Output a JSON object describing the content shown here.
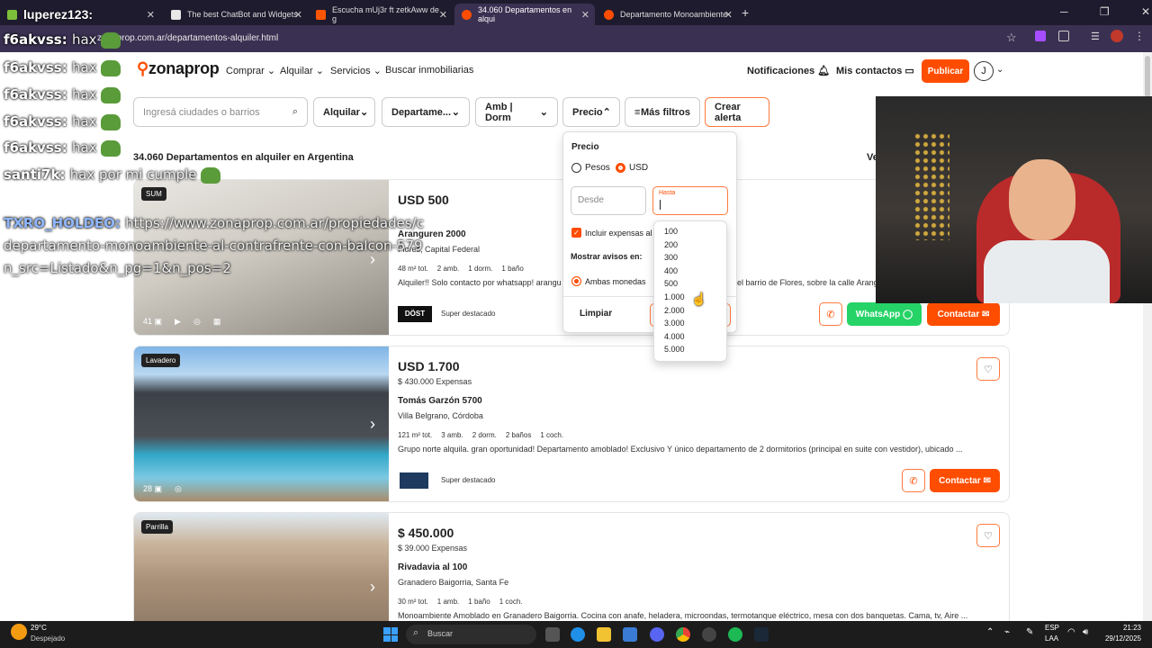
{
  "browser": {
    "tabs": [
      {
        "title": "luperez123:",
        "color": "#7bbf3a"
      },
      {
        "title": "The best ChatBot and Widgets",
        "color": "#e8e8e8"
      },
      {
        "title": "Escucha mUj3r ft zetkAww de g",
        "color": "#ff5500"
      },
      {
        "title": "34.060 Departamentos en alqui",
        "color": "#ff4d00"
      },
      {
        "title": "Departamento Monoambiente",
        "color": "#ff4d00"
      }
    ],
    "url": "zonaprop.com.ar/departamentos-alquiler.html"
  },
  "header": {
    "logo": "zonaprop",
    "nav": [
      "Comprar",
      "Alquilar",
      "Servicios",
      "Buscar inmobiliarias"
    ],
    "notificaciones": "Notificaciones",
    "mis_contactos": "Mis contactos",
    "publicar": "Publicar",
    "avatar_initial": "J"
  },
  "filters": {
    "search_placeholder": "Ingresá ciudades o barrios",
    "operation": "Alquilar",
    "property_type": "Departame...",
    "rooms": "Amb | Dorm",
    "price": "Precio",
    "more_filters": "Más filtros",
    "create_alert": "Crear alerta"
  },
  "results_title": "34.060 Departamentos en alquiler en Argentina",
  "results_right_partial": "Ve",
  "price_panel": {
    "title": "Precio",
    "currency_pesos": "Pesos",
    "currency_usd": "USD",
    "selected_currency": "USD",
    "desde_placeholder": "Desde",
    "hasta_label": "Hasta",
    "include_expenses": "Incluir expensas al",
    "show_listings_label": "Mostrar avisos en:",
    "both_currencies": "Ambas monedas",
    "clear": "Limpiar",
    "options": [
      "100",
      "200",
      "300",
      "400",
      "500",
      "1.000",
      "2.000",
      "3.000",
      "4.000",
      "5.000"
    ]
  },
  "listings": [
    {
      "tag": "SUM",
      "price": "USD 500",
      "address": "Aranguren 2000",
      "location": "Flores, Capital Federal",
      "features": [
        "48 m² tot.",
        "2 amb.",
        "1 dorm.",
        "1 baño"
      ],
      "description": "Alquiler!! Solo contacto por whatsapp! arangu",
      "description_tail": "el barrio de Flores, sobre la calle Arangu",
      "photos": "41",
      "publisher": "DÖST",
      "highlight": "Super destacado",
      "whatsapp": "WhatsApp",
      "contact": "Contactar"
    },
    {
      "tag": "Lavadero",
      "price": "USD 1.700",
      "expenses": "$ 430.000 Expensas",
      "address": "Tomás Garzón 5700",
      "location": "Villa Belgrano, Córdoba",
      "features": [
        "121 m² tot.",
        "3 amb.",
        "2 dorm.",
        "2 baños",
        "1 coch."
      ],
      "description": "Grupo norte alquila. gran oportunidad! Departamento amoblado! Exclusivo Y único departamento de 2 dormitorios (principal en suite con vestidor), ubicado ...",
      "photos": "28",
      "highlight": "Super destacado",
      "contact": "Contactar"
    },
    {
      "tag": "Parrilla",
      "price": "$ 450.000",
      "expenses": "$ 39.000 Expensas",
      "address": "Rivadavia al 100",
      "location": "Granadero Baigorria, Santa Fe",
      "features": [
        "30 m² tot.",
        "1 amb.",
        "1 baño",
        "1 coch."
      ],
      "description": "Monoambiente Amoblado en Granadero Baigorria. Cocina con anafe, heladera, microondas, termotanque eléctrico, mesa con dos banquetas. Cama, tv, Aire ..."
    }
  ],
  "chat": [
    {
      "user": "f6akvss:",
      "msg": "hax"
    },
    {
      "user": "f6akvss:",
      "msg": "hax"
    },
    {
      "user": "f6akvss:",
      "msg": "hax"
    },
    {
      "user": "f6akvss:",
      "msg": "hax"
    },
    {
      "user": "f6akvss:",
      "msg": "hax"
    },
    {
      "user": "santi7k:",
      "msg": "hax por mi cumple"
    },
    {
      "user": "TXRO_HOLDEO:",
      "msg": "https://www.zonaprop.com.ar/propiedades/c"
    },
    {
      "user": "",
      "msg": "departamento-monoambiente-al-contrafrente-con-balcon-579"
    },
    {
      "user": "",
      "msg": "n_src=Listado&n_pg=1&n_pos=2"
    }
  ],
  "taskbar": {
    "weather_temp": "29°C",
    "weather_desc": "Despejado",
    "search": "Buscar",
    "lang": "ESP",
    "region": "LAA",
    "time": "21:23",
    "date": "29/12/2025"
  },
  "colors": {
    "brand": "#ff4d00",
    "whatsapp": "#25d366",
    "chrome": "#1f1b2e"
  }
}
